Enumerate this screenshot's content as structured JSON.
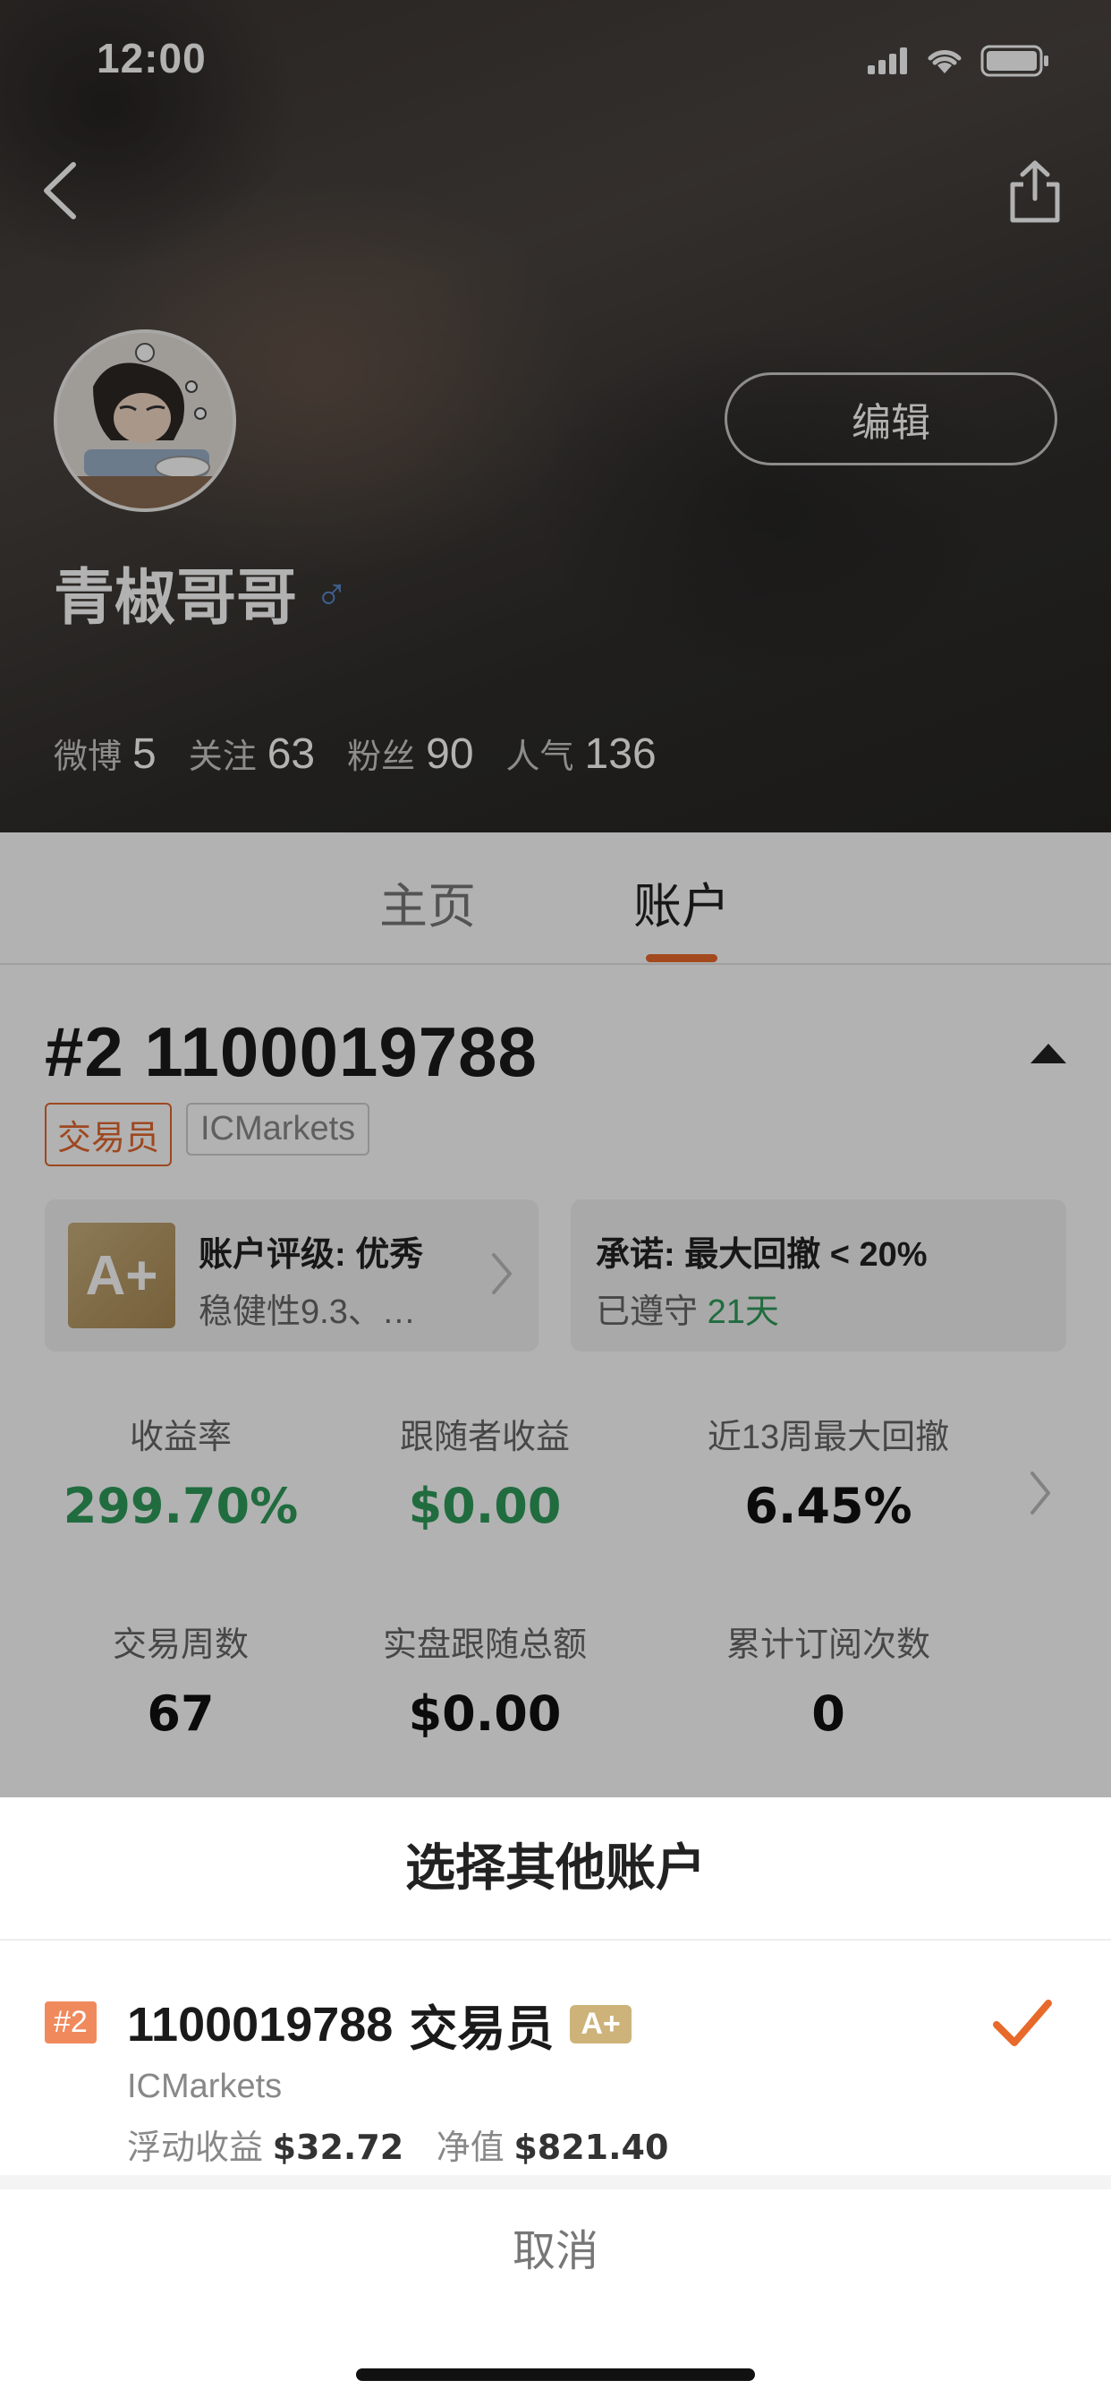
{
  "status_bar": {
    "time": "12:00"
  },
  "profile": {
    "name": "青椒哥哥",
    "gender_symbol": "♂",
    "edit_label": "编辑",
    "stats": [
      {
        "label": "微博",
        "value": "5"
      },
      {
        "label": "关注",
        "value": "63"
      },
      {
        "label": "粉丝",
        "value": "90"
      },
      {
        "label": "人气",
        "value": "136"
      }
    ]
  },
  "tabs": [
    {
      "label": "主页",
      "active": false
    },
    {
      "label": "账户",
      "active": true
    }
  ],
  "account": {
    "title": "#2 1100019788",
    "tag_role": "交易员",
    "tag_broker": "ICMarkets",
    "rating_card": {
      "badge": "A+",
      "title": "账户评级: 优秀",
      "subtitle": "稳健性9.3、…"
    },
    "promise_card": {
      "title": "承诺: 最大回撤 < 20%",
      "kept_prefix": "已遵守",
      "kept_days": "21天"
    },
    "metrics": [
      {
        "label": "收益率",
        "value": "299.70%",
        "color": "#2e9b5b"
      },
      {
        "label": "跟随者收益",
        "value": "$0.00",
        "color": "#2e9b5b"
      },
      {
        "label": "近13周最大回撤",
        "value": "6.45%",
        "color": "#111111"
      },
      {
        "label": "交易周数",
        "value": "67",
        "color": "#111111"
      },
      {
        "label": "实盘跟随总额",
        "value": "$0.00",
        "color": "#111111"
      },
      {
        "label": "累计订阅次数",
        "value": "0",
        "color": "#111111"
      }
    ]
  },
  "sheet": {
    "title": "选择其他账户",
    "rows": [
      {
        "num_tag": "#2",
        "account": "1100019788",
        "role": "交易员",
        "badge": "A+",
        "broker": "ICMarkets",
        "floating_label": "浮动收益",
        "floating_value": "$32.72",
        "equity_label": "净值",
        "equity_value": "$821.40",
        "selected": true
      }
    ],
    "cancel_label": "取消"
  },
  "colors": {
    "accent": "#e86a2a",
    "positive": "#2e9b5b",
    "badge_gold": "#c8ae7c"
  }
}
